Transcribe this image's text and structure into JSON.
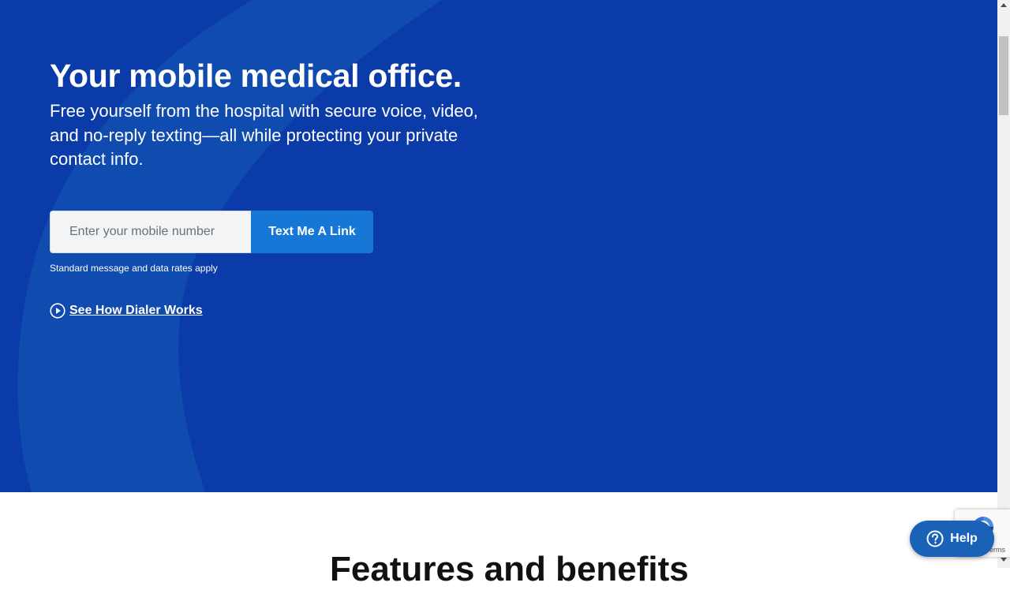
{
  "hero": {
    "title": "Your mobile medical office.",
    "subtitle": "Free yourself from the hospital with secure voice, video, and no-reply texting—all while protecting your private contact info.",
    "phone_input": {
      "placeholder": "Enter your mobile number",
      "value": ""
    },
    "cta_label": "Text Me A Link",
    "disclaimer": "Standard message and data rates apply",
    "video_link_label": "See How Dialer Works",
    "play_icon": "play-circle-icon"
  },
  "features": {
    "title": "Features and benefits"
  },
  "recaptcha": {
    "terms_fragment": "erms",
    "icon": "recaptcha-icon"
  },
  "help_widget": {
    "label": "Help",
    "icon": "question-circle-icon"
  },
  "colors": {
    "hero_background": "#0b3ba8",
    "hero_curve": "#1250b0",
    "cta_button": "#1777d6",
    "help_button": "#1a62b8",
    "text_light": "#ffffff"
  }
}
